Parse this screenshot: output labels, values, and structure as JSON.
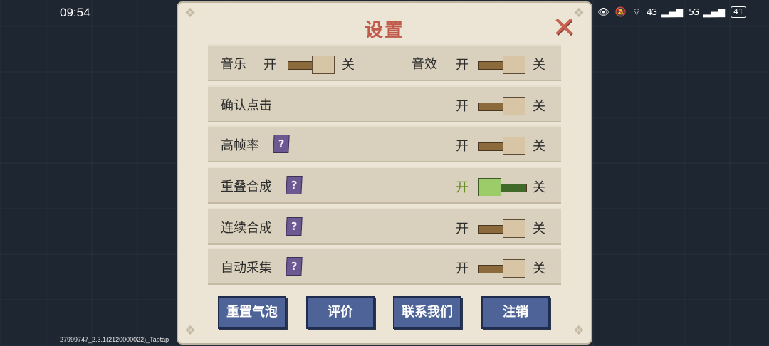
{
  "status": {
    "time": "09:54",
    "net1": "4G",
    "net2": "5G",
    "battery": "41"
  },
  "build_info": "27999747_2.3.1(2120000022)_Taptap",
  "dialog": {
    "title": "设置",
    "close_icon": "close-x-icon"
  },
  "settings": [
    {
      "label": "音乐",
      "on": "开",
      "off": "关",
      "state": "off"
    },
    {
      "label": "音效",
      "on": "开",
      "off": "关",
      "state": "off"
    },
    {
      "label": "确认点击",
      "on": "开",
      "off": "关",
      "state": "off"
    },
    {
      "label": "高帧率",
      "help": "?",
      "on": "开",
      "off": "关",
      "state": "off"
    },
    {
      "label": "重叠合成",
      "help": "?",
      "on": "开",
      "off": "关",
      "state": "on"
    },
    {
      "label": "连续合成",
      "help": "?",
      "on": "开",
      "off": "关",
      "state": "off"
    },
    {
      "label": "自动采集",
      "help": "?",
      "on": "开",
      "off": "关",
      "state": "off"
    }
  ],
  "buttons": {
    "reset": "重置气泡",
    "rate": "评价",
    "contact": "联系我们",
    "logout": "注销"
  },
  "colors": {
    "accent_title": "#c15a4a",
    "button_blue": "#4e6499",
    "help_purple": "#6d5991",
    "switch_on_green": "#9ccb6a"
  }
}
